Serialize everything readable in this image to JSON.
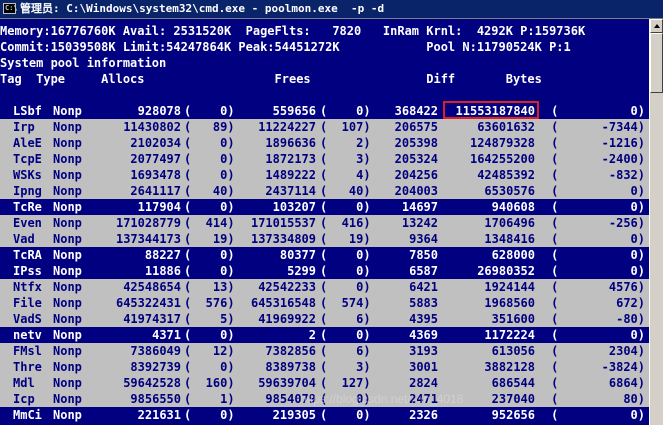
{
  "window": {
    "title": "管理员: C:\\Windows\\system32\\cmd.exe - poolmon.exe  -p -d"
  },
  "header_lines": [
    "Memory:16776760K Avail: 2531520K  PageFlts:   7820   InRam Krnl:  4292K P:159736K",
    "Commit:15039508K Limit:54247864K Peak:54451272K            Pool N:11790524K P:1",
    "System pool information",
    "Tag  Type     Allocs                  Frees                Diff       Bytes"
  ],
  "rows": [
    {
      "tag": "LSbf",
      "type": "Nonp",
      "allocs": "928078",
      "allocs_delta": "0",
      "frees": "559656",
      "frees_delta": "0",
      "diff": "368422",
      "bytes": "11553187840",
      "bytes_delta": "0",
      "style": "blue"
    },
    {
      "tag": "Irp",
      "type": "Nonp",
      "allocs": "11430802",
      "allocs_delta": "89",
      "frees": "11224227",
      "frees_delta": "107",
      "diff": "206575",
      "bytes": "63601632",
      "bytes_delta": "-7344",
      "style": "gray"
    },
    {
      "tag": "AleE",
      "type": "Nonp",
      "allocs": "2102034",
      "allocs_delta": "0",
      "frees": "1896636",
      "frees_delta": "2",
      "diff": "205398",
      "bytes": "124879328",
      "bytes_delta": "-1216",
      "style": "gray"
    },
    {
      "tag": "TcpE",
      "type": "Nonp",
      "allocs": "2077497",
      "allocs_delta": "0",
      "frees": "1872173",
      "frees_delta": "3",
      "diff": "205324",
      "bytes": "164255200",
      "bytes_delta": "-2400",
      "style": "gray"
    },
    {
      "tag": "WSKs",
      "type": "Nonp",
      "allocs": "1693478",
      "allocs_delta": "0",
      "frees": "1489222",
      "frees_delta": "4",
      "diff": "204256",
      "bytes": "42485392",
      "bytes_delta": "-832",
      "style": "gray"
    },
    {
      "tag": "Ipng",
      "type": "Nonp",
      "allocs": "2641117",
      "allocs_delta": "40",
      "frees": "2437114",
      "frees_delta": "40",
      "diff": "204003",
      "bytes": "6530576",
      "bytes_delta": "0",
      "style": "gray"
    },
    {
      "tag": "TcRe",
      "type": "Nonp",
      "allocs": "117904",
      "allocs_delta": "0",
      "frees": "103207",
      "frees_delta": "0",
      "diff": "14697",
      "bytes": "940608",
      "bytes_delta": "0",
      "style": "blue"
    },
    {
      "tag": "Even",
      "type": "Nonp",
      "allocs": "171028779",
      "allocs_delta": "414",
      "frees": "171015537",
      "frees_delta": "416",
      "diff": "13242",
      "bytes": "1706496",
      "bytes_delta": "-256",
      "style": "gray"
    },
    {
      "tag": "Vad",
      "type": "Nonp",
      "allocs": "137344173",
      "allocs_delta": "19",
      "frees": "137334809",
      "frees_delta": "19",
      "diff": "9364",
      "bytes": "1348416",
      "bytes_delta": "0",
      "style": "gray"
    },
    {
      "tag": "TcRA",
      "type": "Nonp",
      "allocs": "88227",
      "allocs_delta": "0",
      "frees": "80377",
      "frees_delta": "0",
      "diff": "7850",
      "bytes": "628000",
      "bytes_delta": "0",
      "style": "blue"
    },
    {
      "tag": "IPss",
      "type": "Nonp",
      "allocs": "11886",
      "allocs_delta": "0",
      "frees": "5299",
      "frees_delta": "0",
      "diff": "6587",
      "bytes": "26980352",
      "bytes_delta": "0",
      "style": "blue"
    },
    {
      "tag": "Ntfx",
      "type": "Nonp",
      "allocs": "42548654",
      "allocs_delta": "13",
      "frees": "42542233",
      "frees_delta": "0",
      "diff": "6421",
      "bytes": "1924144",
      "bytes_delta": "4576",
      "style": "gray"
    },
    {
      "tag": "File",
      "type": "Nonp",
      "allocs": "645322431",
      "allocs_delta": "576",
      "frees": "645316548",
      "frees_delta": "574",
      "diff": "5883",
      "bytes": "1968560",
      "bytes_delta": "672",
      "style": "gray"
    },
    {
      "tag": "VadS",
      "type": "Nonp",
      "allocs": "41974317",
      "allocs_delta": "5",
      "frees": "41969922",
      "frees_delta": "6",
      "diff": "4395",
      "bytes": "351600",
      "bytes_delta": "-80",
      "style": "gray"
    },
    {
      "tag": "netv",
      "type": "Nonp",
      "allocs": "4371",
      "allocs_delta": "0",
      "frees": "2",
      "frees_delta": "0",
      "diff": "4369",
      "bytes": "1172224",
      "bytes_delta": "0",
      "style": "blue"
    },
    {
      "tag": "FMsl",
      "type": "Nonp",
      "allocs": "7386049",
      "allocs_delta": "12",
      "frees": "7382856",
      "frees_delta": "6",
      "diff": "3193",
      "bytes": "613056",
      "bytes_delta": "2304",
      "style": "gray"
    },
    {
      "tag": "Thre",
      "type": "Nonp",
      "allocs": "8392739",
      "allocs_delta": "0",
      "frees": "8389738",
      "frees_delta": "3",
      "diff": "3001",
      "bytes": "3882128",
      "bytes_delta": "-3824",
      "style": "gray"
    },
    {
      "tag": "Mdl",
      "type": "Nonp",
      "allocs": "59642528",
      "allocs_delta": "160",
      "frees": "59639704",
      "frees_delta": "127",
      "diff": "2824",
      "bytes": "686544",
      "bytes_delta": "6864",
      "style": "gray"
    },
    {
      "tag": "Icp",
      "type": "Nonp",
      "allocs": "9856550",
      "allocs_delta": "1",
      "frees": "9854079",
      "frees_delta": "0",
      "diff": "2471",
      "bytes": "237040",
      "bytes_delta": "80",
      "style": "gray"
    },
    {
      "tag": "MmCi",
      "type": "Nonp",
      "allocs": "221631",
      "allocs_delta": "0",
      "frees": "219305",
      "frees_delta": "0",
      "diff": "2326",
      "bytes": "952656",
      "bytes_delta": "0",
      "style": "blue"
    }
  ],
  "watermark": "https://blog.csdn.net/...in_4018"
}
